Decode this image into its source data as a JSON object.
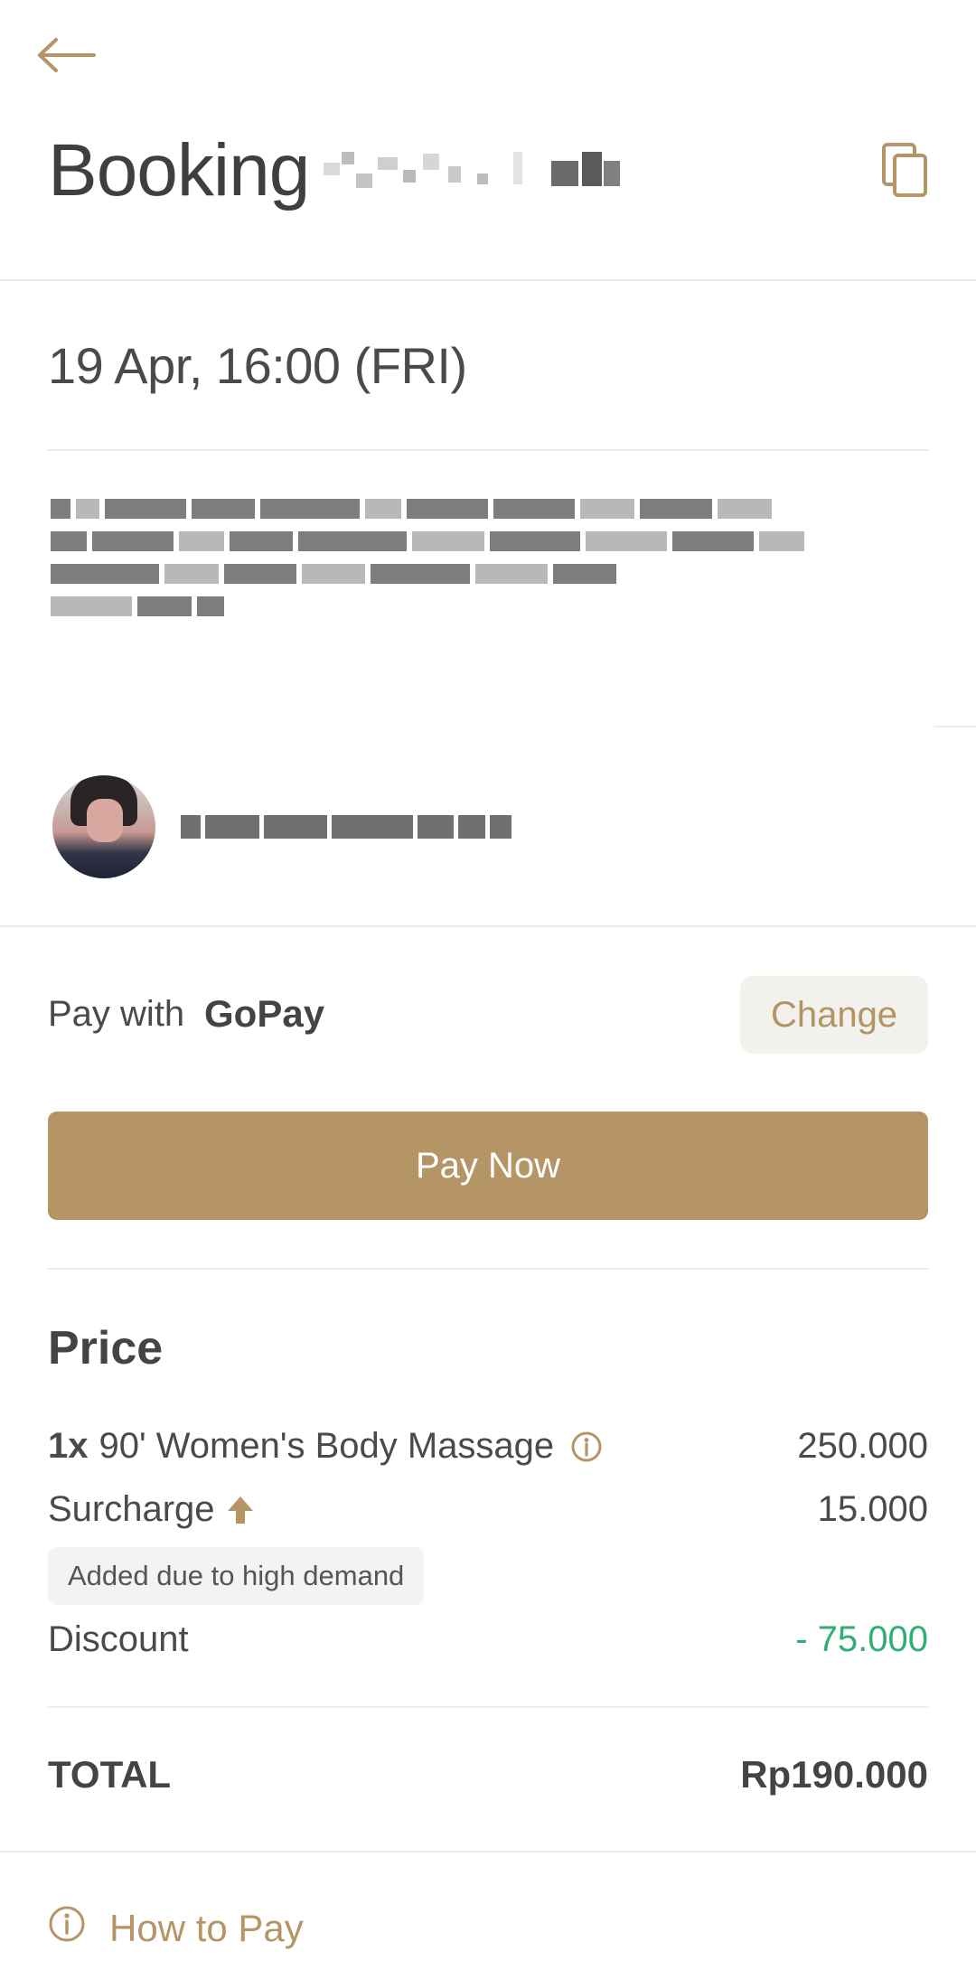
{
  "header": {
    "title": "Booking",
    "booking_code_redacted": true
  },
  "icons": {
    "back": "arrow-left-icon",
    "copy": "copy-icon",
    "info": "info-circle-icon",
    "surcharge": "arrow-up-icon"
  },
  "booking": {
    "datetime": "19 Apr, 16:00 (FRI)",
    "address_redacted": true,
    "therapist_name_redacted": true
  },
  "payment": {
    "label": "Pay with",
    "method": "GoPay",
    "change_label": "Change",
    "pay_now_label": "Pay Now"
  },
  "price": {
    "title": "Price",
    "items": [
      {
        "qty": "1x",
        "name": "90' Women's Body Massage",
        "amount": "250.000"
      }
    ],
    "surcharge": {
      "label": "Surcharge",
      "amount": "15.000",
      "note": "Added due to high demand"
    },
    "discount": {
      "label": "Discount",
      "amount": "- 75.000"
    },
    "total": {
      "label": "TOTAL",
      "amount": "Rp190.000"
    }
  },
  "help": {
    "how_to_pay_label": "How to Pay"
  },
  "colors": {
    "accent": "#b59566",
    "discount_green": "#2fae75",
    "change_bg": "#f2f1ec"
  }
}
